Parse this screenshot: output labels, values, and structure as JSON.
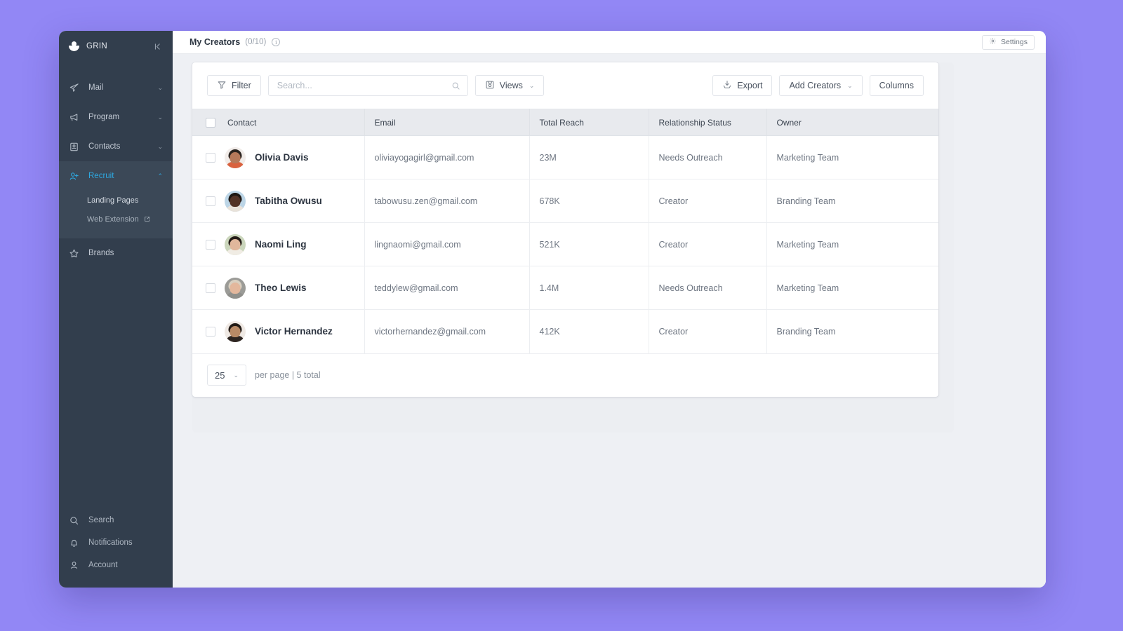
{
  "theme": {
    "desktop_bg": "#9287f5",
    "sidebar_bg": "#323e4d",
    "accent": "#2ea8e0",
    "page_bg": "#eef0f4"
  },
  "sidebar": {
    "brand": "GRIN",
    "collapse_label": "←|",
    "items": [
      {
        "label": "Mail",
        "icon": "paper-plane-icon",
        "caret": "⌄"
      },
      {
        "label": "Program",
        "icon": "megaphone-icon",
        "caret": "⌄"
      },
      {
        "label": "Contacts",
        "icon": "contact-card-icon",
        "caret": "⌄"
      },
      {
        "label": "Recruit",
        "icon": "user-plus-icon",
        "caret": "⌃",
        "active": true
      },
      {
        "label": "Brands",
        "icon": "star-icon",
        "caret": ""
      }
    ],
    "recruit_subitems": [
      {
        "label": "Landing Pages",
        "external": false
      },
      {
        "label": "Web Extension",
        "external": true
      }
    ],
    "bottom_items": [
      {
        "label": "Search",
        "icon": "search-icon"
      },
      {
        "label": "Notifications",
        "icon": "bell-icon"
      },
      {
        "label": "Account",
        "icon": "person-icon"
      }
    ]
  },
  "header": {
    "title": "My Creators",
    "count": "(0/10)",
    "info_glyph": "i",
    "settings_label": "Settings"
  },
  "toolbar": {
    "filter_label": "Filter",
    "search_placeholder": "Search...",
    "search_value": "",
    "views_label": "Views",
    "views_caret": "⌄",
    "export_label": "Export",
    "add_creators_label": "Add Creators",
    "add_creators_caret": "⌄",
    "columns_label": "Columns"
  },
  "table": {
    "columns": [
      "Contact",
      "Email",
      "Total Reach",
      "Relationship Status",
      "Owner"
    ],
    "rows": [
      {
        "name": "Olivia Davis",
        "email": "oliviayogagirl@gmail.com",
        "reach": "23M",
        "relationship": "Needs Outreach",
        "owner": "Marketing Team",
        "avatar": {
          "bg": "#f1ece9",
          "hair": "#2b2420",
          "skin": "#b6795a",
          "shirt": "#d9623f"
        }
      },
      {
        "name": "Tabitha Owusu",
        "email": "tabowusu.zen@gmail.com",
        "reach": "678K",
        "relationship": "Creator",
        "owner": "Branding Team",
        "avatar": {
          "bg": "#bcd5e6",
          "hair": "#1d1713",
          "skin": "#523225",
          "shirt": "#e8e2da"
        }
      },
      {
        "name": "Naomi Ling",
        "email": "lingnaomi@gmail.com",
        "reach": "521K",
        "relationship": "Creator",
        "owner": "Marketing Team",
        "avatar": {
          "bg": "#cbd6bc",
          "hair": "#241c17",
          "skin": "#e0b79c",
          "shirt": "#f0ece4"
        }
      },
      {
        "name": "Theo Lewis",
        "email": "teddylew@gmail.com",
        "reach": "1.4M",
        "relationship": "Needs Outreach",
        "owner": "Marketing Team",
        "avatar": {
          "bg": "#9b9b97",
          "hair": "#d8cfc0",
          "skin": "#e3b79c",
          "shirt": "#8f8f8b"
        }
      },
      {
        "name": "Victor Hernandez",
        "email": "victorhernandez@gmail.com",
        "reach": "412K",
        "relationship": "Creator",
        "owner": "Branding Team",
        "avatar": {
          "bg": "#efe9e4",
          "hair": "#221a15",
          "skin": "#b98a66",
          "shirt": "#2d2420"
        }
      }
    ]
  },
  "pagination": {
    "per_page_value": "25",
    "per_page_caret": "⌄",
    "summary": "per page | 5 total"
  }
}
